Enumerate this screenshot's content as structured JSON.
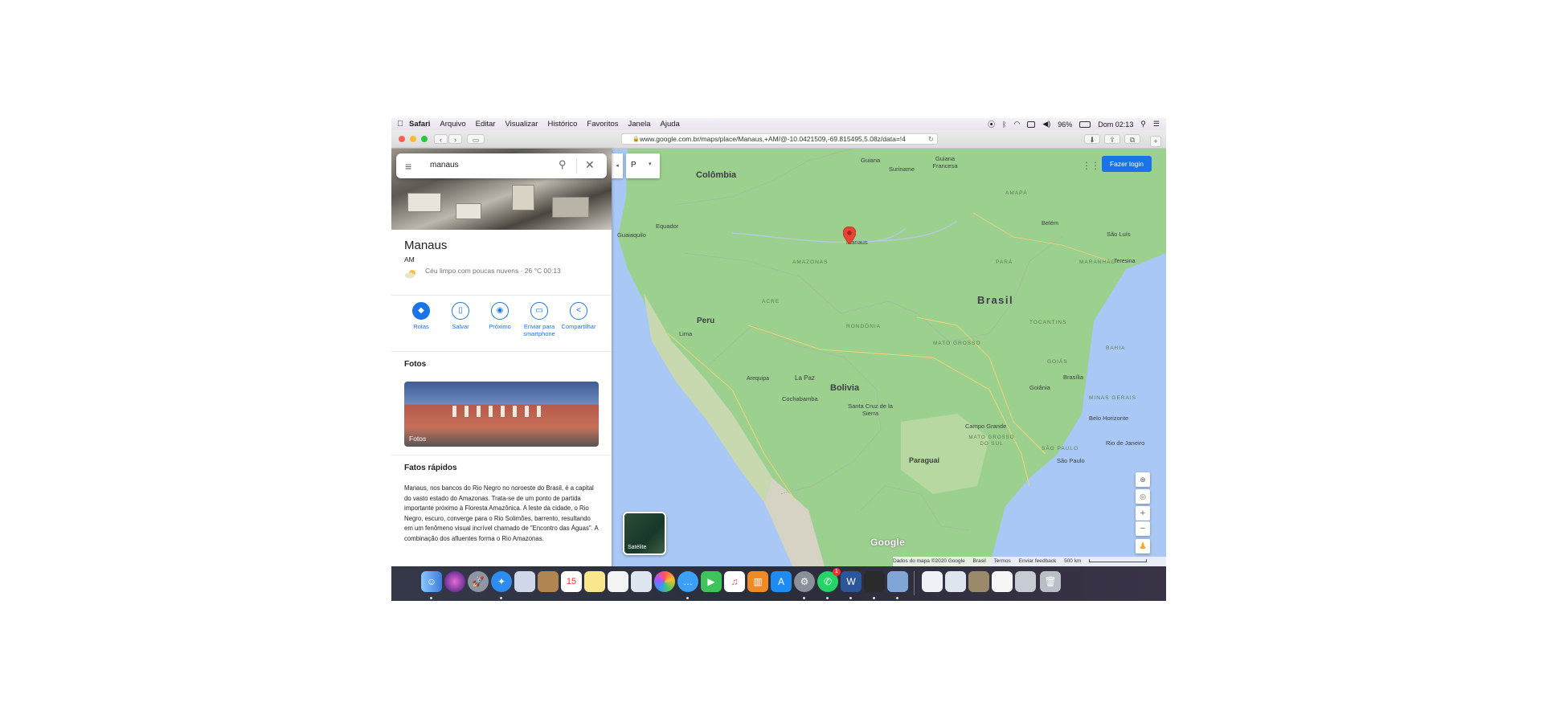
{
  "menubar": {
    "apple": "",
    "items": [
      "Safari",
      "Arquivo",
      "Editar",
      "Visualizar",
      "Histórico",
      "Favoritos",
      "Janela",
      "Ajuda"
    ],
    "battery": "96%",
    "clock": "Dom 02:13"
  },
  "browser": {
    "url": "www.google.com.br/maps/place/Manaus,+AM/@-10.0421509,-69.815495,5.08z/data=!4",
    "reload": "↻"
  },
  "search": {
    "query": "manaus",
    "menu_icon": "≡",
    "search_icon": "⚲",
    "clear_icon": "✕"
  },
  "place": {
    "title": "Manaus",
    "subtitle": "AM",
    "weather": "Céu limpo com poucas nuvens · 26 °C 00:13",
    "actions": [
      {
        "label": "Rotas",
        "icon": "directions-icon",
        "glyph": "◆"
      },
      {
        "label": "Salvar",
        "icon": "bookmark-icon",
        "glyph": "▯"
      },
      {
        "label": "Próximo",
        "icon": "nearby-icon",
        "glyph": "◉"
      },
      {
        "label": "Enviar para smartphone",
        "icon": "phone-icon",
        "glyph": "▭"
      },
      {
        "label": "Compartilhar",
        "icon": "share-icon",
        "glyph": "<"
      }
    ],
    "photos_title": "Fotos",
    "photos_label": "Fotos",
    "facts_title": "Fatos rápidos",
    "facts_text": "Manaus, nos bancos do Rio Negro no noroeste do Brasil, é a capital do vasto estado do Amazonas. Trata-se de um ponto de partida importante próximo à Floresta Amazônica. A leste da cidade, o Rio Negro, escuro, converge para o Rio Solimões, barrento, resultando em um fenômeno visual incrível chamado de \"Encontro das Águas\". A combinação dos afluentes forma o Rio Amazonas."
  },
  "map": {
    "layer_button": "P",
    "login_button": "Fazer login",
    "satellite_label": "Satélite",
    "google_logo": "Google",
    "labels": {
      "guiana": "Guiana",
      "suriname": "Suriname",
      "guiana_francesa": "Guiana Francesa",
      "colombia": "Colômbia",
      "equador": "Equador",
      "guaiaquilo": "Guaiaquilo",
      "belem": "Belém",
      "sao_luis": "São Luís",
      "teresina": "Teresina",
      "amazonas": "AMAZONAS",
      "para": "PARÁ",
      "maranhao": "MARANHÃO",
      "amapa": "AMAPÁ",
      "manaus": "Manaus",
      "brasil": "Brasil",
      "acre": "ACRE",
      "rondonia": "RONDÔNIA",
      "peru": "Peru",
      "lima": "Lima",
      "mato_grosso": "MATO GROSSO",
      "tocantins": "TOCANTINS",
      "bahia": "BAHIA",
      "goias": "GOIÁS",
      "goiania": "Goiânia",
      "brasilia": "Brasília",
      "minas_gerais": "MINAS GERAIS",
      "belo_horizonte": "Belo Horizonte",
      "la_paz": "La Paz",
      "bolivia": "Bolivia",
      "cochabamba": "Cochabamba",
      "santa_cruz": "Santa Cruz de la Sierra",
      "arequipa": "Arequipa",
      "campo_grande": "Campo Grande",
      "ms": "MATO GROSSO DO SUL",
      "sao_paulo": "SÃO PAULO",
      "sao_paulo_city": "São Paulo",
      "rio": "Rio de Janeiro",
      "paraguai": "Paraguai"
    },
    "footer": {
      "data": "Dados do mapa ©2020 Google",
      "country": "Brasil",
      "terms": "Termos",
      "feedback": "Enviar feedback",
      "scale": "500 km"
    },
    "controls": [
      "⊕",
      "◎",
      "+",
      "−",
      "♟"
    ]
  },
  "dock": {
    "calendar_day": "15",
    "whatsapp_badge": "1"
  },
  "colors": {
    "accent": "#1a73e8",
    "land": "#9bd08e",
    "water": "#aac8f5",
    "pin": "#ea4335"
  }
}
